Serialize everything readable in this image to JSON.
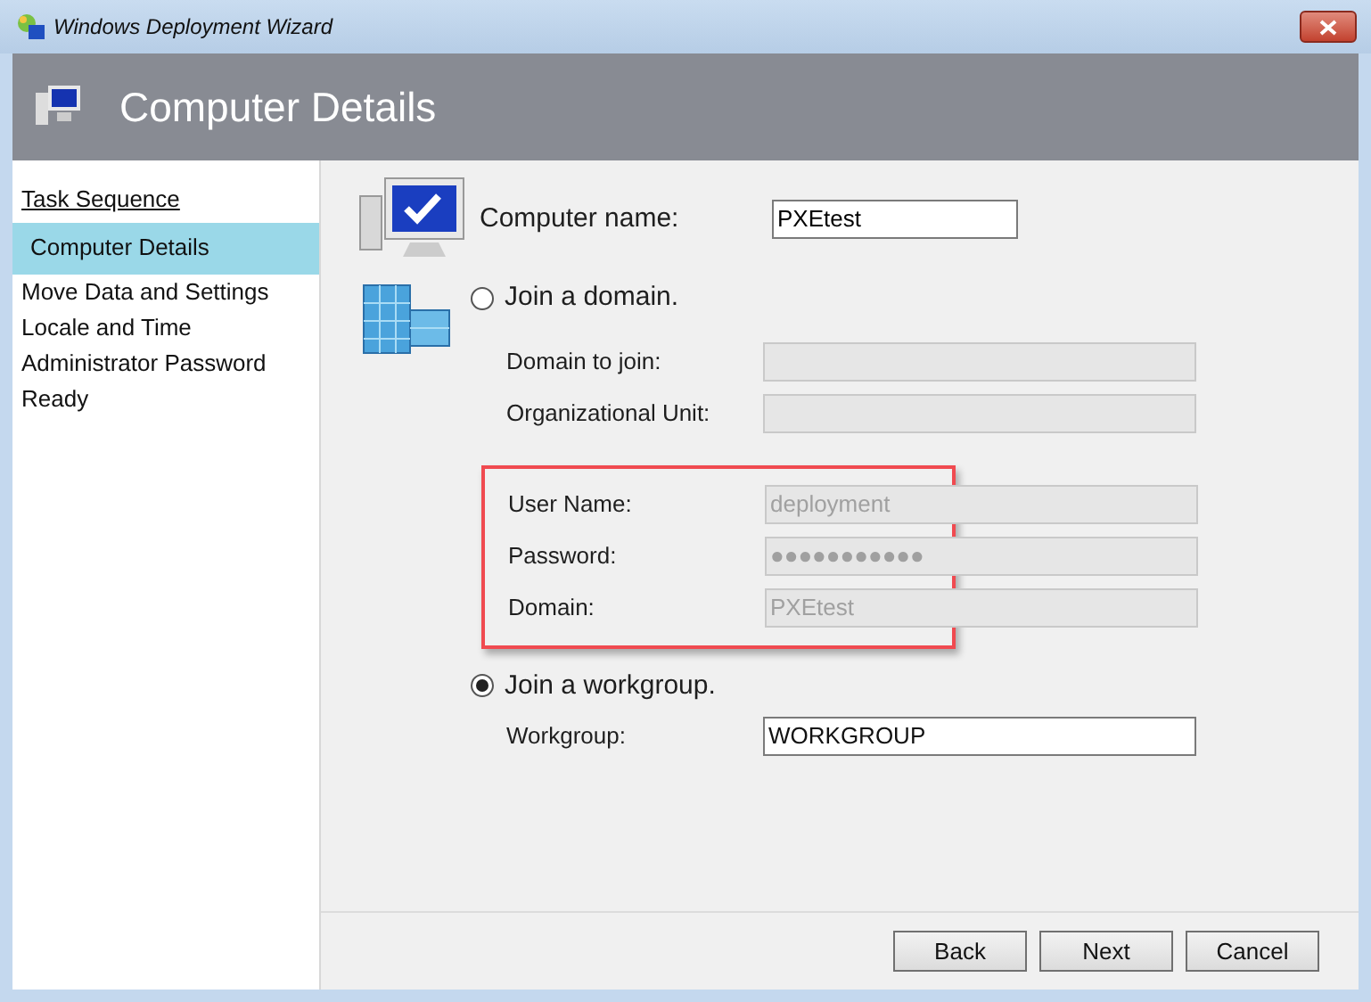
{
  "window": {
    "title": "Windows Deployment Wizard"
  },
  "header": {
    "title": "Computer Details"
  },
  "sidebar": {
    "heading": "Task Sequence",
    "items": [
      {
        "label": "Computer Details",
        "selected": true
      },
      {
        "label": "Move Data and Settings",
        "selected": false
      },
      {
        "label": "Locale and Time",
        "selected": false
      },
      {
        "label": "Administrator Password",
        "selected": false
      },
      {
        "label": "Ready",
        "selected": false
      }
    ]
  },
  "computer_name": {
    "label": "Computer name:",
    "value": "PXEtest"
  },
  "join_domain": {
    "label": "Join a domain.",
    "selected": false,
    "fields": [
      {
        "label": "Domain to join:",
        "disabled": true
      },
      {
        "label": "Organizational Unit:",
        "disabled": true
      }
    ],
    "credentials": {
      "highlighted": true,
      "fields": [
        {
          "label": "User Name:",
          "value": "deployment",
          "disabled": true
        },
        {
          "label": "Password:",
          "value": "●●●●●●●●●●●",
          "disabled": true
        },
        {
          "label": "Domain:",
          "value": "PXEtest",
          "disabled": true
        }
      ]
    }
  },
  "join_workgroup": {
    "label": "Join a workgroup.",
    "selected": true,
    "fields": [
      {
        "label": "Workgroup:",
        "value": "WORKGROUP",
        "disabled": false
      }
    ]
  },
  "buttons": [
    "Back",
    "Next",
    "Cancel"
  ]
}
